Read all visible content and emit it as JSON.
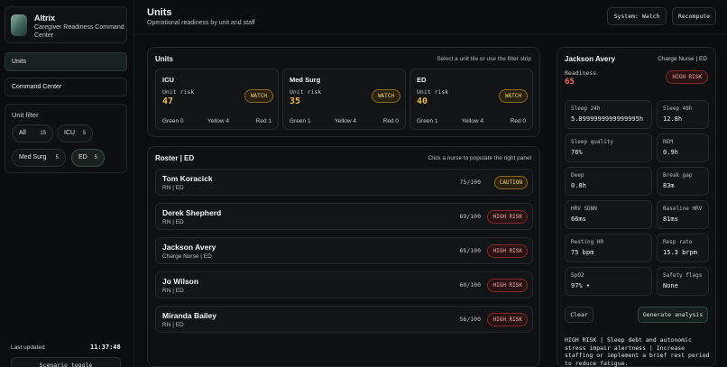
{
  "brand": {
    "title": "Altrix",
    "subtitle": "Caregiver Readiness Command Center"
  },
  "nav": {
    "units": "Units",
    "command_center": "Command Center"
  },
  "filter": {
    "title": "Unit filter",
    "chips": [
      {
        "label": "All",
        "count": "15"
      },
      {
        "label": "ICU",
        "count": "5"
      },
      {
        "label": "Med Surg",
        "count": "5"
      },
      {
        "label": "ED",
        "count": "5"
      }
    ],
    "active": "ED"
  },
  "footer": {
    "updated_label": "Last updated",
    "updated_time": "11:37:48",
    "scenario_button": "Scenario toggle"
  },
  "header": {
    "title": "Units",
    "subtitle": "Operational readiness by unit and staff",
    "status_button": "System: Watch",
    "recompute_button": "Recompute"
  },
  "units": {
    "title": "Units",
    "hint": "Select a unit tile or use the filter strip",
    "cards": [
      {
        "name": "ICU",
        "risk_label": "Unit risk",
        "risk": "47",
        "badge": "WATCH",
        "green": "Green 0",
        "yellow": "Yellow 4",
        "red": "Red 1"
      },
      {
        "name": "Med Surg",
        "risk_label": "Unit risk",
        "risk": "35",
        "badge": "WATCH",
        "green": "Green 1",
        "yellow": "Yellow 4",
        "red": "Red 0"
      },
      {
        "name": "ED",
        "risk_label": "Unit risk",
        "risk": "40",
        "badge": "WATCH",
        "green": "Green 1",
        "yellow": "Yellow 4",
        "red": "Red 0"
      }
    ]
  },
  "roster": {
    "title": "Roster | ED",
    "hint": "Click a nurse to populate the right panel",
    "nurses": [
      {
        "name": "Tom Koracick",
        "role": "RN | ED",
        "score": "75/100",
        "badge": "CAUTION"
      },
      {
        "name": "Derek Shepherd",
        "role": "RN | ED",
        "score": "69/100",
        "badge": "HIGH RISK"
      },
      {
        "name": "Jackson Avery",
        "role": "Charge Nurse | ED",
        "score": "65/100",
        "badge": "HIGH RISK"
      },
      {
        "name": "Jo Wilson",
        "role": "RN | ED",
        "score": "60/100",
        "badge": "HIGH RISK"
      },
      {
        "name": "Miranda Bailey",
        "role": "RN | ED",
        "score": "56/100",
        "badge": "HIGH RISK"
      }
    ]
  },
  "detail": {
    "name": "Jackson Avery",
    "role": "Charge Nurse | ED",
    "readiness_label": "Readiness",
    "readiness": "65",
    "badge": "HIGH RISK",
    "metrics": [
      {
        "label": "Sleep 24h",
        "value": "5.8999999999999995h"
      },
      {
        "label": "Sleep 48h",
        "value": "12.8h"
      },
      {
        "label": "Sleep quality",
        "value": "76%"
      },
      {
        "label": "REM",
        "value": "0.9h"
      },
      {
        "label": "Deep",
        "value": "0.8h"
      },
      {
        "label": "Break gap",
        "value": "83m"
      },
      {
        "label": "HRV SDNN",
        "value": "66ms"
      },
      {
        "label": "Baseline HRV",
        "value": "81ms"
      },
      {
        "label": "Resting HR",
        "value": "75 bpm"
      },
      {
        "label": "Resp rate",
        "value": "15.3 brpm"
      },
      {
        "label": "SpO2",
        "value": "97% •"
      },
      {
        "label": "Safety flags",
        "value": "None"
      }
    ],
    "clear_button": "Clear",
    "generate_button": "Generate analysis",
    "analysis": "HIGH RISK | Sleep debt and autonomic stress impair alertness | Increase staffing or implement a brief rest period to reduce fatigue."
  },
  "colors": {
    "background": "#0b0c0d",
    "watch": "#e6b84a",
    "high_risk": "#ef6d6d",
    "accent": "#2f4a41"
  }
}
